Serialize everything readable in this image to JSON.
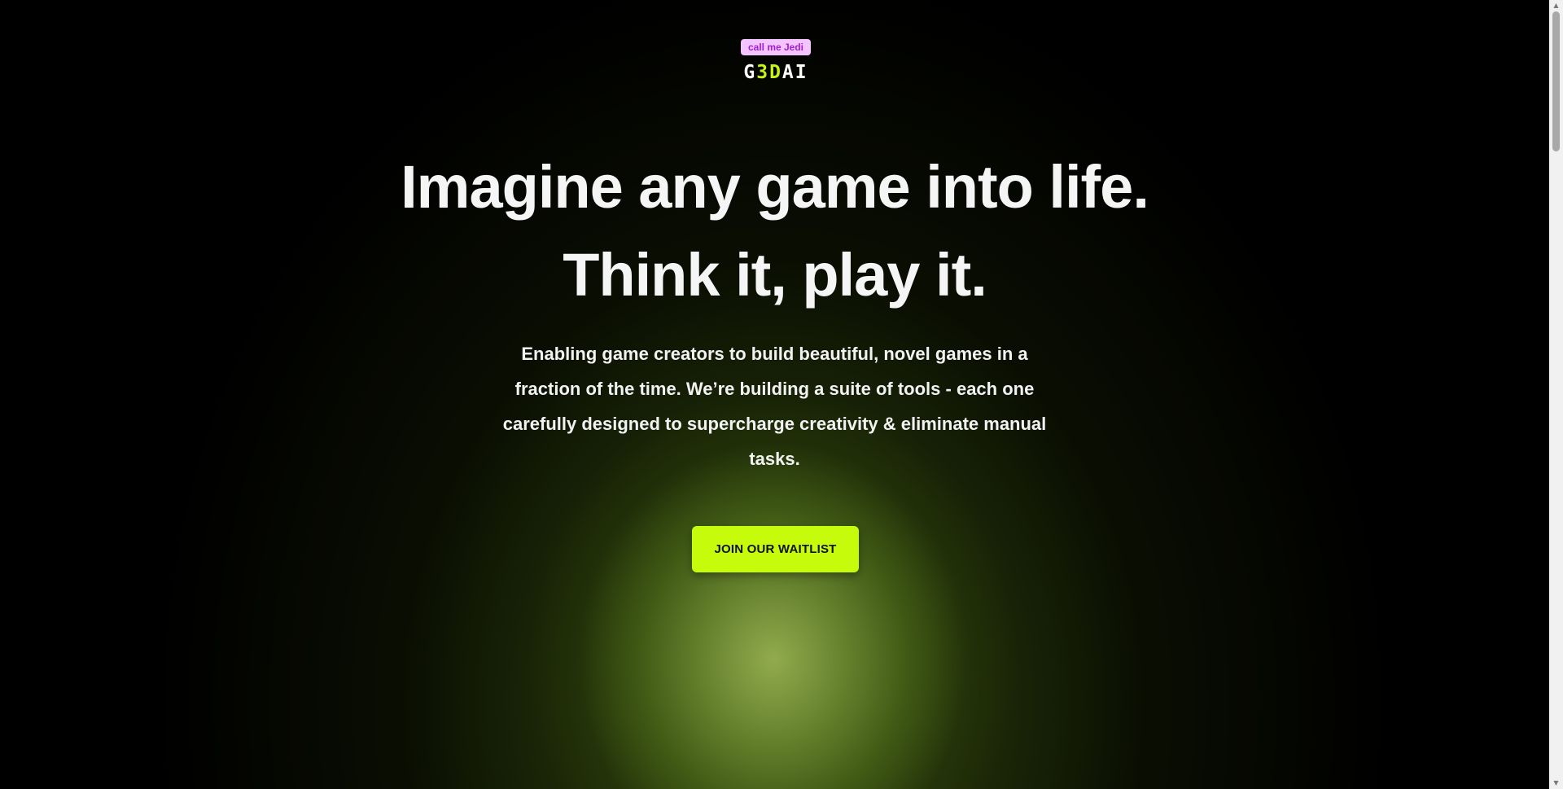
{
  "badge": {
    "text": "call me Jedi"
  },
  "logo": {
    "part1": "G",
    "accent": "3D",
    "part2": "AI"
  },
  "hero": {
    "headline_line1": "Imagine any game into life.",
    "headline_line2": "Think it, play it.",
    "subtitle": "Enabling game creators to build beautiful, novel games in a fraction of the time. We’re building a suite of tools - each one carefully designed to supercharge creativity & eliminate manual tasks.",
    "cta_label": "JOIN OUR WAITLIST"
  },
  "scrollbar": {
    "up_icon": "▲",
    "down_icon": "▼"
  },
  "colors": {
    "background": "#000000",
    "accent": "#c6fb0b",
    "badge_bg": "#f3c4ff",
    "badge_text": "#a01fd6",
    "glow": "#96b050"
  }
}
